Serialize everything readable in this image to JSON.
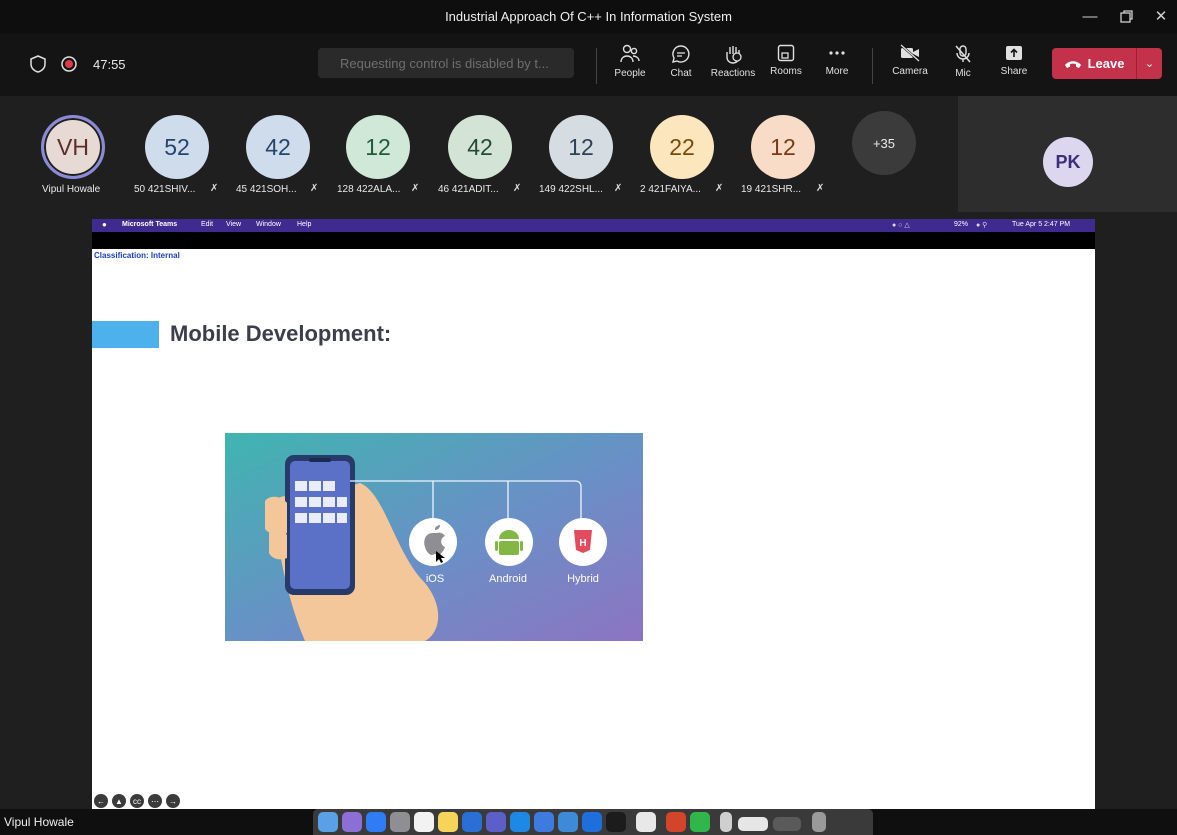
{
  "window": {
    "title": "Industrial Approach Of C++ In Information System"
  },
  "toolbar": {
    "timer": "47:55",
    "request_control": "Requesting control is disabled by t...",
    "people": "People",
    "chat": "Chat",
    "reactions": "Reactions",
    "rooms": "Rooms",
    "more": "More",
    "camera": "Camera",
    "mic": "Mic",
    "share": "Share",
    "leave": "Leave"
  },
  "participants": [
    {
      "initials": "VH",
      "name": "Vipul Howale"
    },
    {
      "initials": "52",
      "name": "50 421SHIV..."
    },
    {
      "initials": "42",
      "name": "45 421SOH..."
    },
    {
      "initials": "12",
      "name": "128 422ALA..."
    },
    {
      "initials": "42",
      "name": "46 421ADIT..."
    },
    {
      "initials": "12",
      "name": "149 422SHL..."
    },
    {
      "initials": "22",
      "name": "2 421FAIYA..."
    },
    {
      "initials": "12",
      "name": "19 421SHR..."
    }
  ],
  "overflow": "+35",
  "pinned": {
    "initials": "PK"
  },
  "shared": {
    "menubar": {
      "app": "Microsoft Teams",
      "items": [
        "Edit",
        "View",
        "Window",
        "Help"
      ],
      "battery": "92%",
      "clock": "Tue Apr 5  2:47 PM"
    },
    "classification": "Classification: Internal",
    "slide_title": "Mobile Development:",
    "platforms": [
      "iOS",
      "Android",
      "Hybrid"
    ]
  },
  "footer": {
    "presenter": "Vipul Howale"
  },
  "colors": {
    "leave": "#c4314b",
    "accent_blue": "#4db2ec",
    "mac_menubar": "#3f2b8f"
  }
}
